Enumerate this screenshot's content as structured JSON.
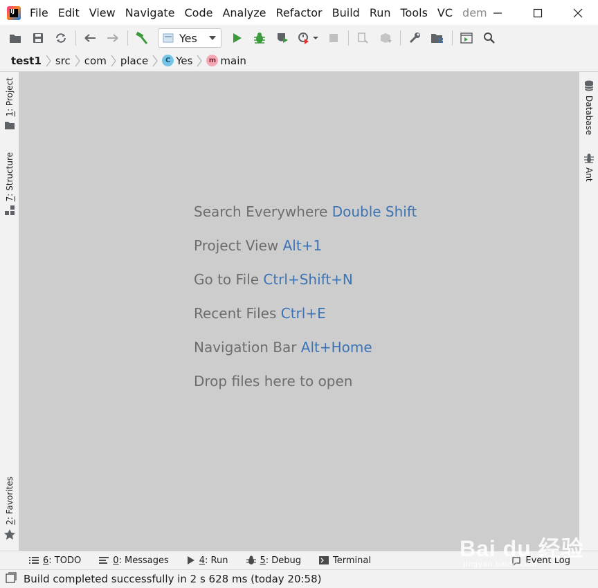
{
  "menubar": {
    "items": [
      "File",
      "Edit",
      "View",
      "Navigate",
      "Code",
      "Analyze",
      "Refactor",
      "Build",
      "Run",
      "Tools",
      "VC"
    ],
    "project_title": "dem"
  },
  "toolbar": {
    "run_config": "Yes"
  },
  "breadcrumb": {
    "items": [
      "test1",
      "src",
      "com",
      "place",
      "Yes",
      "main"
    ],
    "class_badge": "C",
    "method_badge": "m"
  },
  "left_stripe": {
    "project": {
      "num": "1",
      "label": ": Project"
    },
    "structure": {
      "num": "7",
      "label": ": Structure"
    },
    "favorites": {
      "num": "2",
      "label": ": Favorites"
    }
  },
  "right_stripe": {
    "database": "Database",
    "ant": "Ant"
  },
  "editor": {
    "hints": [
      {
        "text": "Search Everywhere ",
        "key": "Double Shift"
      },
      {
        "text": "Project View ",
        "key": "Alt+1"
      },
      {
        "text": "Go to File ",
        "key": "Ctrl+Shift+N"
      },
      {
        "text": "Recent Files ",
        "key": "Ctrl+E"
      },
      {
        "text": "Navigation Bar ",
        "key": "Alt+Home"
      },
      {
        "text": "Drop files here to open",
        "key": ""
      }
    ]
  },
  "bottombar": {
    "todo": {
      "num": "6",
      "label": ": TODO"
    },
    "messages": {
      "num": "0",
      "label": ": Messages"
    },
    "run": {
      "num": "4",
      "label": ": Run"
    },
    "debug": {
      "num": "5",
      "label": ": Debug"
    },
    "terminal": "Terminal",
    "event_log": "Event Log"
  },
  "statusbar": {
    "text": "Build completed successfully in 2 s 628 ms (today 20:58)"
  },
  "watermark": {
    "text": "Bai du 经验",
    "sub": "jingyan.baidu.com"
  },
  "colors": {
    "editor_bg": "#cdcdcd",
    "hint_text": "#6d6d6d",
    "hint_key": "#3d73b3",
    "run_green": "#3c9a3c"
  }
}
